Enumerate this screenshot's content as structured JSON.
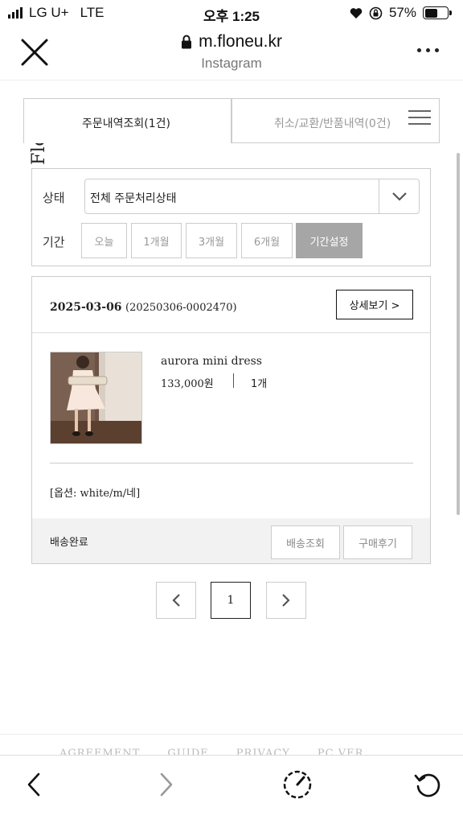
{
  "status_bar": {
    "carrier": "LG U+",
    "network": "LTE",
    "time": "오후 1:25",
    "battery": "57%",
    "battery_level": 0.57
  },
  "browser": {
    "url": "m.floneu.kr",
    "subtitle": "Instagram"
  },
  "logo": {
    "text": "Floneu"
  },
  "tabs": [
    {
      "label": "주문내역조회(1건)",
      "active": true
    },
    {
      "label": "취소/교환/반품내역(0건)",
      "active": false
    }
  ],
  "filter": {
    "status_label": "상태",
    "status_value": "전체 주문처리상태",
    "period_label": "기간",
    "period_options": [
      "오늘",
      "1개월",
      "3개월",
      "6개월",
      "기간설정"
    ],
    "active_period": "기간설정"
  },
  "order": {
    "date": "2025-03-06",
    "order_number": "(20250306-0002470)",
    "detail_button": "상세보기 >",
    "product_name": "aurora mini dress",
    "price": "133,000원",
    "quantity": "1개",
    "option": "[옵션: white/m/네]",
    "status": "배송완료",
    "track_button": "배송조회",
    "review_button": "구매후기"
  },
  "pagination": {
    "current_page": "1"
  },
  "footer": {
    "links": [
      "AGREEMENT",
      "GUIDE",
      "PRIVACY",
      "PC VER."
    ]
  },
  "icons": {
    "close": "close-icon",
    "lock": "lock-icon",
    "more": "more-icon",
    "menu": "hamburger-icon",
    "dropdown": "chevron-down-icon",
    "prev_page": "chevron-left-icon",
    "next_page": "chevron-right-icon",
    "back": "back-icon",
    "forward": "forward-icon",
    "share": "compass-icon",
    "reload": "reload-icon"
  }
}
